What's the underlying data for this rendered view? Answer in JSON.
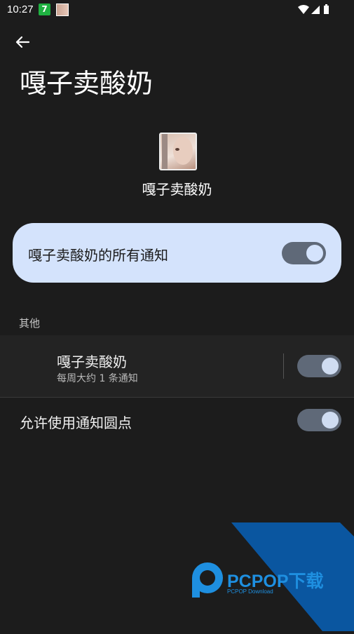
{
  "status_bar": {
    "time": "10:27",
    "badge": "7"
  },
  "header": {
    "title": "嘎子卖酸奶"
  },
  "app": {
    "name": "嘎子卖酸奶"
  },
  "master_switch": {
    "label": "嘎子卖酸奶的所有通知",
    "on": true
  },
  "section": {
    "header": "其他"
  },
  "channel": {
    "title": "嘎子卖酸奶",
    "subtitle": "每周大约 1 条通知",
    "on": true
  },
  "notification_dot": {
    "label": "允许使用通知圆点",
    "on": true
  },
  "watermark": {
    "brand": "PCPOP下载",
    "tagline": "PCPOP Download"
  },
  "colors": {
    "background": "#1c1c1c",
    "card": "#d4e3fc",
    "toggle_track": "#5f6978",
    "watermark_blue": "#0a56a0"
  }
}
